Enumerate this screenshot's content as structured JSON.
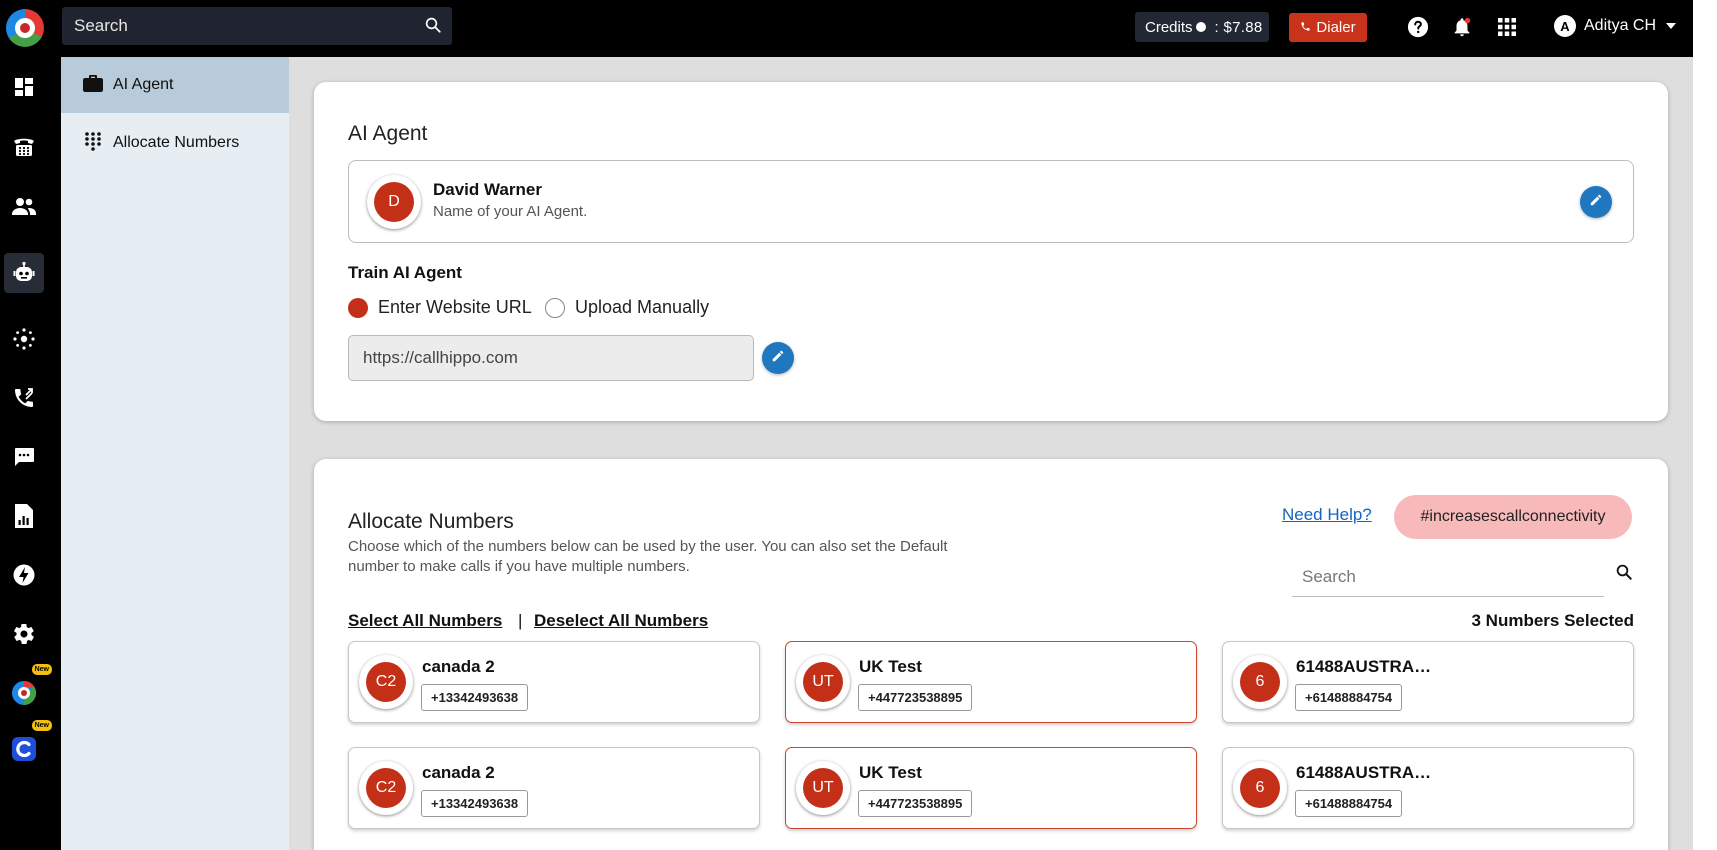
{
  "topbar": {
    "search_placeholder": "Search",
    "credits_label": "Credits",
    "credits_value": ": $7.88",
    "dialer_label": "Dialer",
    "user_initial": "A",
    "user_name": "Aditya CH"
  },
  "rail": {
    "new_badge": "New"
  },
  "submenu": {
    "items": [
      {
        "label": "AI Agent"
      },
      {
        "label": "Allocate Numbers"
      }
    ]
  },
  "ai_agent": {
    "title": "AI Agent",
    "agent_initial": "D",
    "agent_name": "David Warner",
    "agent_sub": "Name of your AI Agent.",
    "train_title": "Train AI Agent",
    "option_website": "Enter Website URL",
    "option_manual": "Upload Manually",
    "url_value": "https://callhippo.com"
  },
  "allocate": {
    "title": "Allocate Numbers",
    "description": "Choose which of the numbers below can be used by the user. You can also set the Default number to make calls if you have multiple numbers.",
    "help_link": "Need Help?",
    "tag": "#increasescallconnectivity",
    "search_placeholder": "Search",
    "select_all": "Select All Numbers",
    "separator": "|",
    "deselect_all": "Deselect All Numbers",
    "selected_count": "3 Numbers Selected",
    "numbers": [
      {
        "initials": "C2",
        "name": "canada 2",
        "phone": "+13342493638",
        "selected": false
      },
      {
        "initials": "UT",
        "name": "UK Test",
        "phone": "+447723538895",
        "selected": true
      },
      {
        "initials": "6",
        "name": "61488AUSTRAL...",
        "phone": "+61488884754",
        "selected": false
      },
      {
        "initials": "C2",
        "name": "canada 2",
        "phone": "+13342493638",
        "selected": false
      },
      {
        "initials": "UT",
        "name": "UK Test",
        "phone": "+447723538895",
        "selected": true
      },
      {
        "initials": "6",
        "name": "61488AUSTRAL...",
        "phone": "+61488884754",
        "selected": false
      }
    ]
  },
  "colors": {
    "brand_red": "#c42f18",
    "accent_blue": "#1f77c0",
    "active_submenu": "#b7cbdb"
  }
}
